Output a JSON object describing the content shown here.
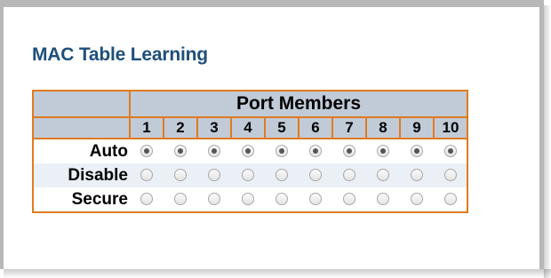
{
  "page": {
    "title": "MAC Table Learning"
  },
  "table": {
    "group_header": "Port Members",
    "ports": [
      "1",
      "2",
      "3",
      "4",
      "5",
      "6",
      "7",
      "8",
      "9",
      "10"
    ],
    "rows": [
      {
        "label": "Auto",
        "selected": [
          true,
          true,
          true,
          true,
          true,
          true,
          true,
          true,
          true,
          true
        ]
      },
      {
        "label": "Disable",
        "selected": [
          false,
          false,
          false,
          false,
          false,
          false,
          false,
          false,
          false,
          false
        ]
      },
      {
        "label": "Secure",
        "selected": [
          false,
          false,
          false,
          false,
          false,
          false,
          false,
          false,
          false,
          false
        ]
      }
    ]
  },
  "colors": {
    "title": "#1e4f7a",
    "border": "#e07b1e",
    "header_bg": "#c1cbd8",
    "alt_row_bg": "#eaf0f6"
  }
}
